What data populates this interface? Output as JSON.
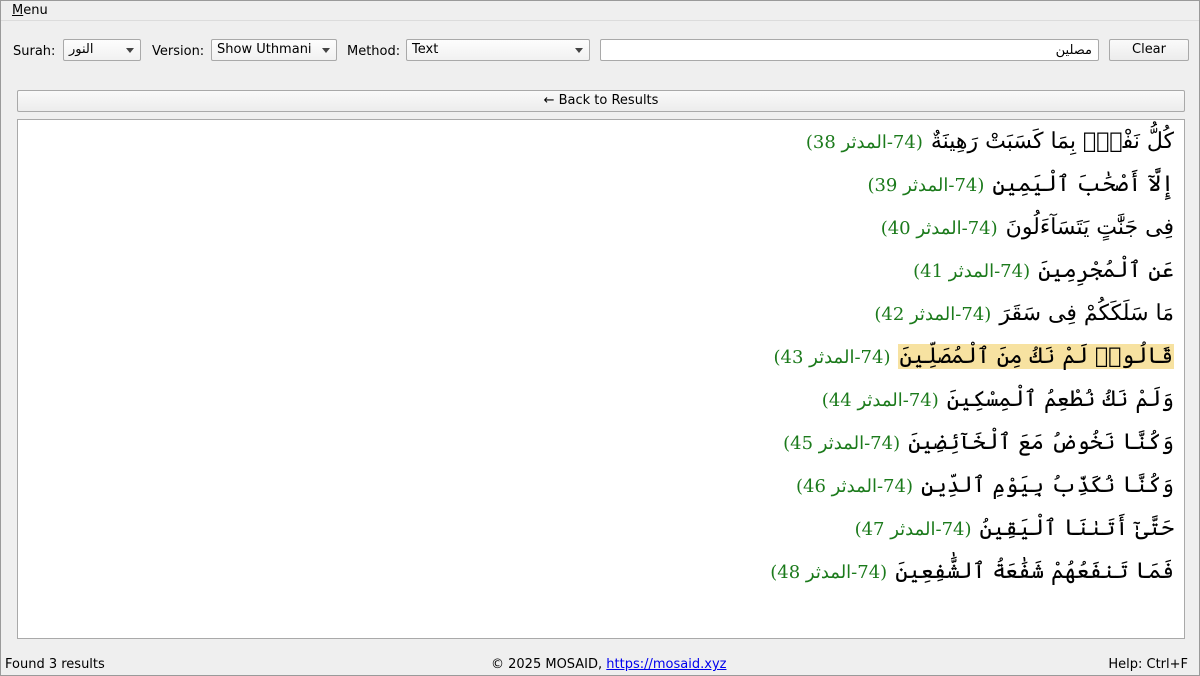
{
  "menubar": {
    "menu_label": "Menu"
  },
  "toolbar": {
    "surah_label": "Surah:",
    "surah_value": "النور",
    "version_label": "Version:",
    "version_value": "Show Uthmani",
    "method_label": "Method:",
    "method_value": "Text",
    "search_value": "مصلين",
    "clear_label": "Clear"
  },
  "back_label": "← Back to Results",
  "verses": [
    {
      "text": "كُلُّ نَفْسٍۭ بِمَا كَسَبَتْ رَهِينَةٌ",
      "ref": "(74-المدثر 38)",
      "highlight": false
    },
    {
      "text": "إِلَّآ أَصْحَٰبَ ٱلْيَمِينِ",
      "ref": "(74-المدثر 39)",
      "highlight": false
    },
    {
      "text": "فِى جَنَّٰتٍ يَتَسَآءَلُونَ",
      "ref": "(74-المدثر 40)",
      "highlight": false
    },
    {
      "text": "عَنِ ٱلْمُجْرِمِينَ",
      "ref": "(74-المدثر 41)",
      "highlight": false
    },
    {
      "text": "مَا سَلَكَكُمْ فِى سَقَرَ",
      "ref": "(74-المدثر 42)",
      "highlight": false
    },
    {
      "text": "قَالُوا۟ لَمْ نَكُ مِنَ ٱلْمُصَلِّينَ",
      "ref": "(74-المدثر 43)",
      "highlight": true
    },
    {
      "text": "وَلَمْ نَكُ نُطْعِمُ ٱلْمِسْكِينَ",
      "ref": "(74-المدثر 44)",
      "highlight": false
    },
    {
      "text": "وَكُنَّا نَخُوضُ مَعَ ٱلْخَآئِضِينَ",
      "ref": "(74-المدثر 45)",
      "highlight": false
    },
    {
      "text": "وَكُنَّا نُكَذِّبُ بِيَوْمِ ٱلدِّينِ",
      "ref": "(74-المدثر 46)",
      "highlight": false
    },
    {
      "text": "حَتَّىٰٓ أَتَىٰنَا ٱلْيَقِينُ",
      "ref": "(74-المدثر 47)",
      "highlight": false
    },
    {
      "text": "فَمَا تَنفَعُهُمْ شَفَٰعَةُ ٱلشَّٰفِعِينَ",
      "ref": "(74-المدثر 48)",
      "highlight": false
    }
  ],
  "status": {
    "left": "Found 3 results",
    "center_prefix": "© 2025 MOSAID, ",
    "center_link": "https://mosaid.xyz",
    "right": "Help: Ctrl+F"
  },
  "colors": {
    "highlight": "#f7e2a1",
    "reference": "#1b7a1b"
  }
}
